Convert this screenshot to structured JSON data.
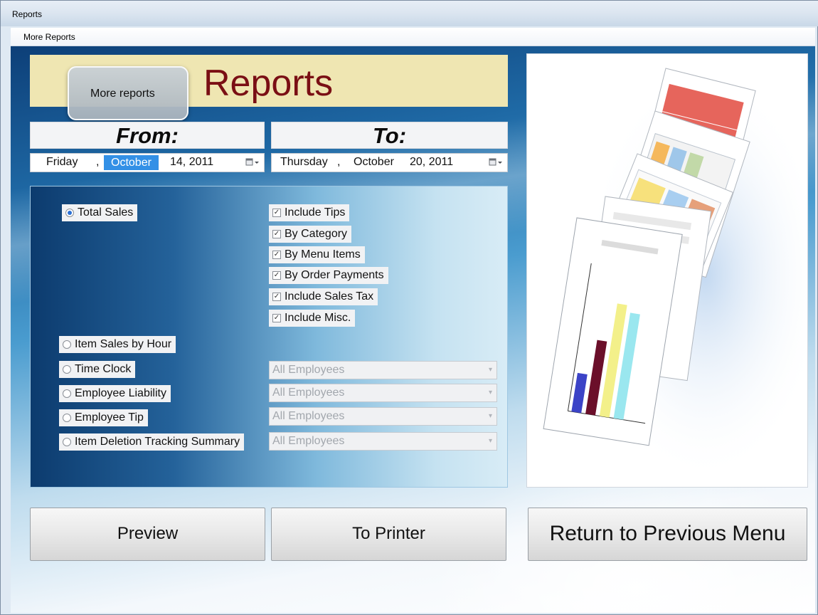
{
  "window": {
    "title": "Reports"
  },
  "menubar": {
    "items": [
      "More Reports"
    ]
  },
  "tooltip": {
    "text": "More reports"
  },
  "header": {
    "title": "Reports"
  },
  "date_range": {
    "from_label": "From:",
    "to_label": "To:",
    "from": {
      "weekday": "Friday",
      "sep": ",",
      "month": "October",
      "day_year": "14, 2011"
    },
    "to": {
      "weekday": "Thursday",
      "sep": ",",
      "month": "October",
      "day_year": "20, 2011"
    },
    "picker_icon": "calendar-dropdown-icon"
  },
  "report_types": {
    "total_sales": {
      "label": "Total Sales",
      "selected": true
    },
    "item_sales_by_hour": {
      "label": "Item Sales by Hour",
      "selected": false
    },
    "time_clock": {
      "label": "Time Clock",
      "selected": false
    },
    "employee_liability": {
      "label": "Employee Liability",
      "selected": false
    },
    "employee_tip": {
      "label": "Employee Tip",
      "selected": false
    },
    "item_deletion_tracking_summary": {
      "label": "Item Deletion Tracking Summary",
      "selected": false
    }
  },
  "total_sales_options": [
    {
      "label": "Include Tips",
      "checked": true
    },
    {
      "label": "By Category",
      "checked": true
    },
    {
      "label": "By Menu Items",
      "checked": true
    },
    {
      "label": "By Order Payments",
      "checked": true
    },
    {
      "label": "Include Sales Tax",
      "checked": true
    },
    {
      "label": "Include Misc.",
      "checked": true
    }
  ],
  "employee_filters": {
    "time_clock": "All Employees",
    "employee_liability": "All Employees",
    "employee_tip": "All Employees",
    "item_deletion_tracking_summary": "All Employees"
  },
  "buttons": {
    "preview": "Preview",
    "to_printer": "To Printer",
    "return": "Return to Previous Menu"
  },
  "colors": {
    "header_banner": "#efe6b2",
    "header_title": "#7a0f14",
    "selection_blue": "#3390e6",
    "panel_dark_blue": "#0c3b6e"
  }
}
